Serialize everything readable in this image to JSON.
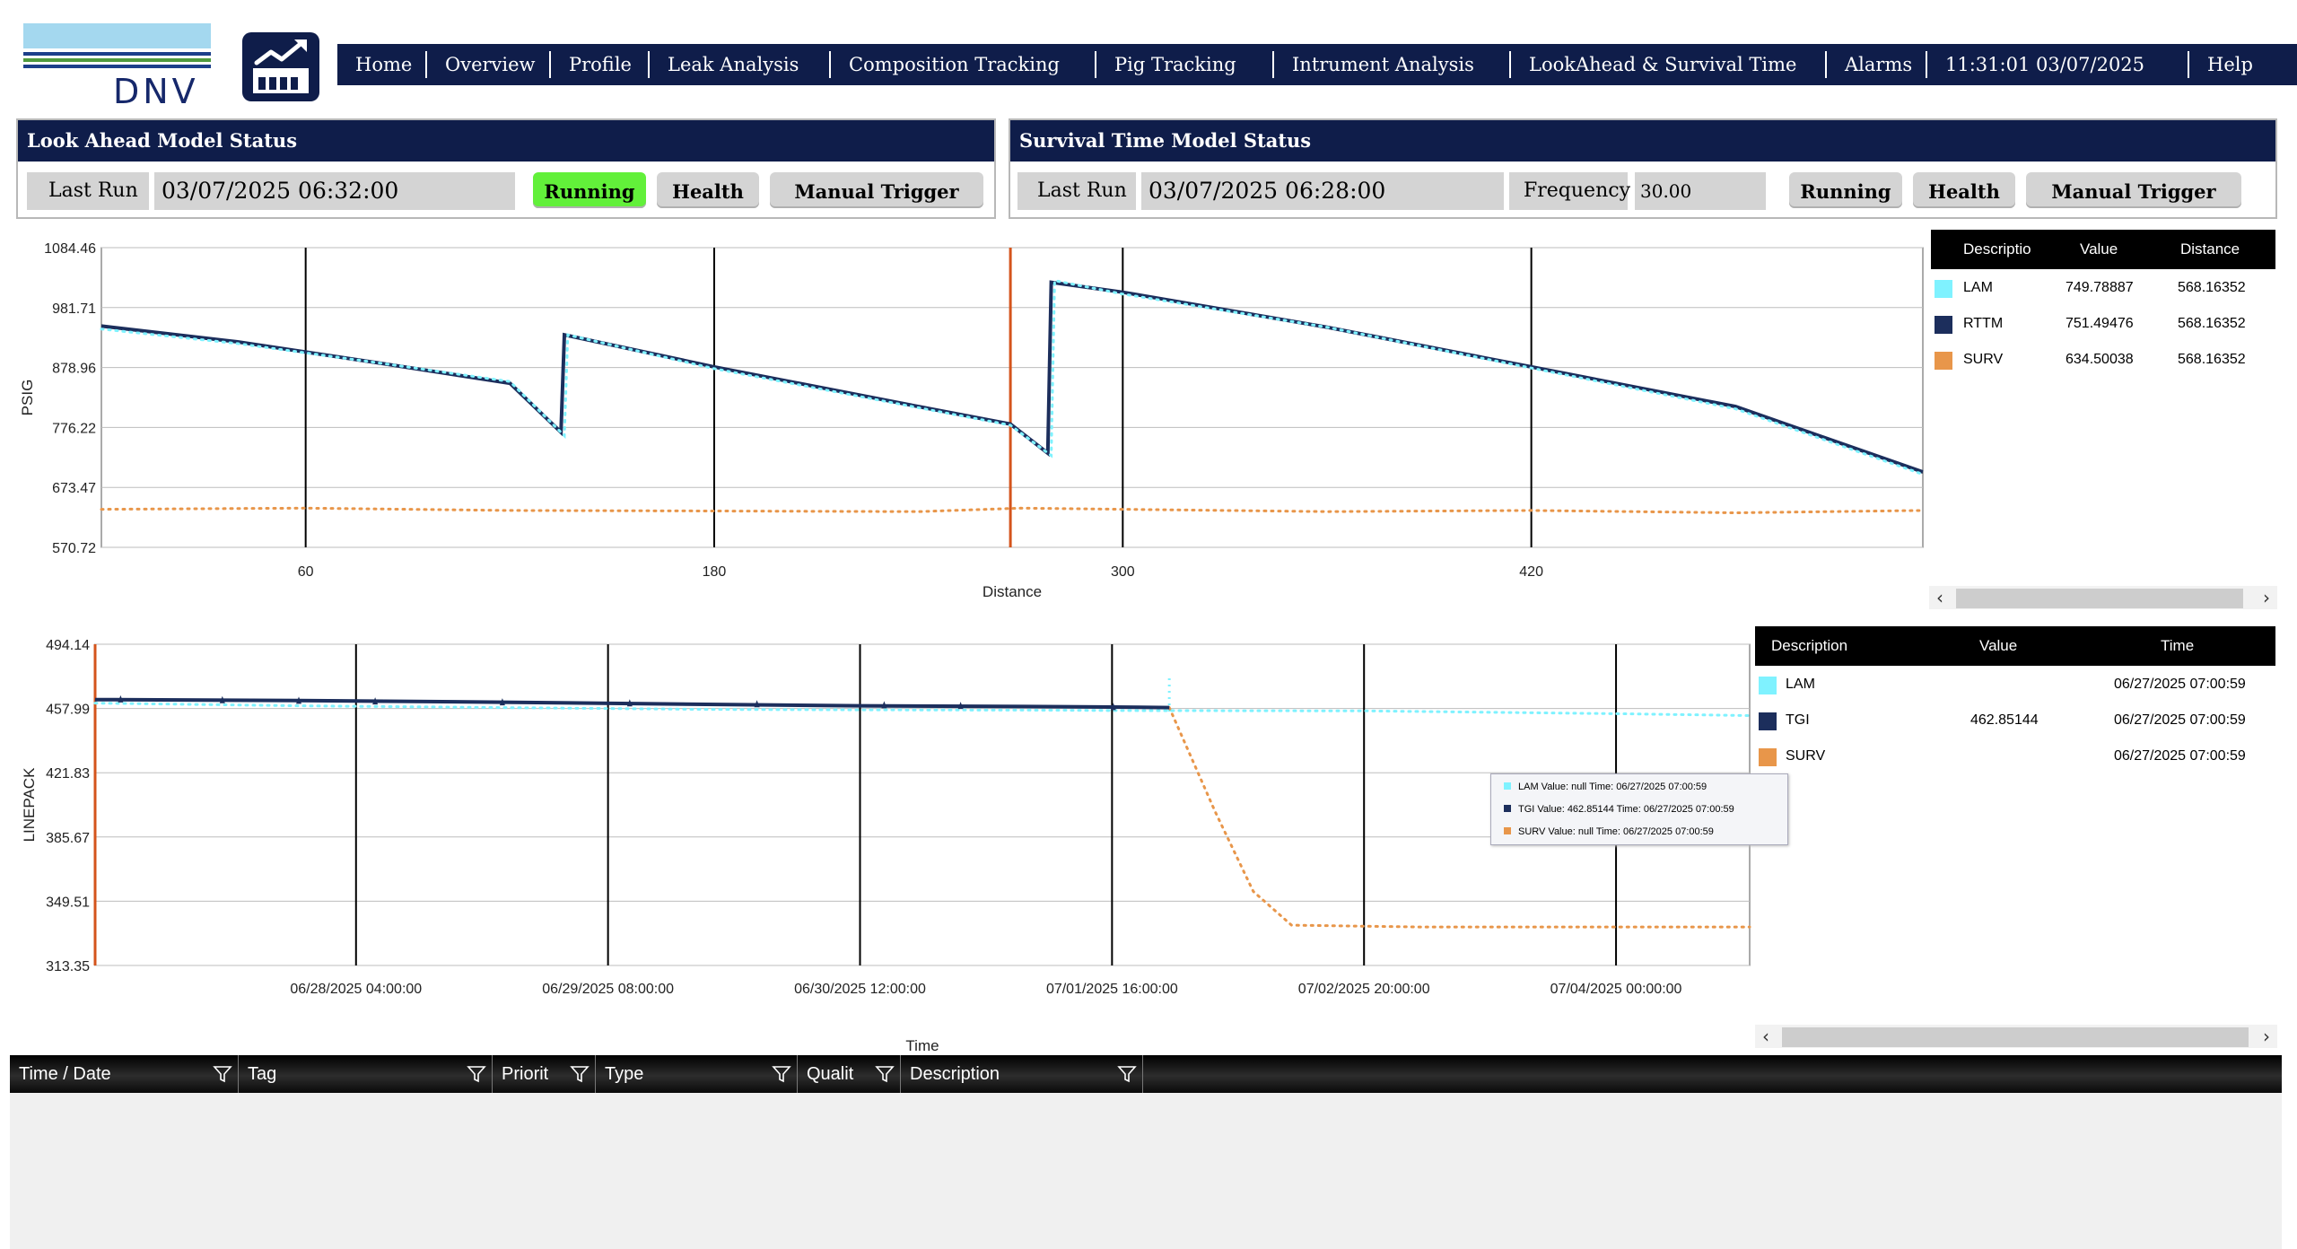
{
  "header": {
    "logo_text": "DNV",
    "nav": [
      "Home",
      "Overview",
      "Profile",
      "Leak Analysis",
      "Composition Tracking",
      "Pig Tracking",
      "Intrument Analysis",
      "LookAhead & Survival Time",
      "Alarms",
      "11:31:01 03/07/2025",
      "Help"
    ]
  },
  "look_ahead": {
    "title": "Look Ahead Model Status",
    "last_run_label": "Last Run",
    "last_run_value": "03/07/2025 06:32:00",
    "status_button": "Running",
    "health_button": "Health",
    "trigger_button": "Manual Trigger"
  },
  "survival": {
    "title": "Survival Time Model Status",
    "last_run_label": "Last Run",
    "last_run_value": "03/07/2025 06:28:00",
    "frequency_label": "Frequency",
    "frequency_value": "30.00",
    "status_button": "Running",
    "health_button": "Health",
    "trigger_button": "Manual Trigger"
  },
  "profile_legend": {
    "headers": [
      "Descriptio",
      "Value",
      "Distance"
    ],
    "rows": [
      {
        "name": "LAM",
        "value": "749.78887",
        "distance": "568.16352",
        "color": "#7ff2ff"
      },
      {
        "name": "RTTM",
        "value": "751.49476",
        "distance": "568.16352",
        "color": "#1c2e5c"
      },
      {
        "name": "SURV",
        "value": "634.50038",
        "distance": "568.16352",
        "color": "#e8964a"
      }
    ]
  },
  "linepack_legend": {
    "headers": [
      "Description",
      "Value",
      "Time"
    ],
    "rows": [
      {
        "name": "LAM",
        "value": "",
        "time": "06/27/2025 07:00:59",
        "color": "#7ff2ff"
      },
      {
        "name": "TGI",
        "value": "462.85144",
        "time": "06/27/2025 07:00:59",
        "color": "#1c2e5c"
      },
      {
        "name": "SURV",
        "value": "",
        "time": "06/27/2025 07:00:59",
        "color": "#e8964a"
      }
    ]
  },
  "tooltip": {
    "lines": [
      {
        "text": "LAM Value: null Time: 06/27/2025 07:00:59",
        "color": "#7ff2ff"
      },
      {
        "text": "TGI Value: 462.85144 Time: 06/27/2025 07:00:59",
        "color": "#1c2e5c"
      },
      {
        "text": "SURV Value: null Time: 06/27/2025 07:00:59",
        "color": "#e8964a"
      }
    ]
  },
  "alarm_grid": {
    "columns": [
      "Time / Date",
      "Tag",
      "Priorit",
      "Type",
      "Qualit",
      "Description"
    ]
  },
  "chart_data": [
    {
      "type": "line",
      "xlabel": "Distance",
      "ylabel": "PSIG",
      "xlim": [
        0,
        535
      ],
      "ylim": [
        570.72,
        1084.46
      ],
      "xticks": [
        60,
        180,
        300,
        420
      ],
      "yticks": [
        "570.72",
        "673.47",
        "776.22",
        "878.96",
        "981.71",
        "1084.46"
      ],
      "marker_x": 267,
      "series": [
        {
          "name": "LAM",
          "color": "#7ff2ff",
          "style": "dotted",
          "x": [
            0,
            40,
            80,
            120,
            136,
            137,
            180,
            240,
            267,
            279,
            280,
            300,
            360,
            420,
            480,
            535
          ],
          "y": [
            945,
            920,
            888,
            855,
            762,
            935,
            877,
            810,
            780,
            728,
            1028,
            1005,
            948,
            878,
            808,
            696
          ]
        },
        {
          "name": "RTTM",
          "color": "#1c2e5c",
          "style": "solid",
          "x": [
            0,
            40,
            80,
            120,
            135,
            136,
            180,
            240,
            267,
            278,
            279,
            300,
            360,
            420,
            480,
            535
          ],
          "y": [
            950,
            923,
            888,
            852,
            768,
            935,
            880,
            812,
            782,
            732,
            1025,
            1008,
            948,
            880,
            812,
            700
          ]
        },
        {
          "name": "SURV",
          "color": "#e8964a",
          "style": "dotted",
          "x": [
            0,
            60,
            120,
            180,
            240,
            270,
            300,
            360,
            420,
            480,
            535
          ],
          "y": [
            636,
            638,
            634,
            633,
            632,
            638,
            636,
            632,
            634,
            630,
            634
          ]
        }
      ]
    },
    {
      "type": "line",
      "xlabel": "Time",
      "ylabel": "LINEPACK",
      "ylim": [
        313.35,
        494.14
      ],
      "xticks": [
        "06/28/2025 04:00:00",
        "06/29/2025 08:00:00",
        "06/30/2025 12:00:00",
        "07/01/2025 16:00:00",
        "07/02/2025 20:00:00",
        "07/04/2025 00:00:00"
      ],
      "yticks": [
        "313.35",
        "349.51",
        "385.67",
        "421.83",
        "457.99",
        "494.14"
      ],
      "series": [
        {
          "name": "LAM",
          "color": "#7ff2ff",
          "style": "dotted",
          "x": [
            0,
            8,
            16,
            24,
            30,
            38,
            40,
            50,
            60,
            65
          ],
          "y": [
            461,
            459.5,
            458.5,
            457.5,
            457.2,
            457,
            456.8,
            456.6,
            455,
            454
          ]
        },
        {
          "name": "TGI",
          "color": "#1c2e5c",
          "style": "solid",
          "x": [
            0,
            8,
            16,
            24,
            30,
            38,
            40,
            42.2
          ],
          "y": [
            463,
            462.5,
            461.5,
            460.3,
            459.5,
            459,
            458.8,
            458.5
          ]
        },
        {
          "name": "SURV",
          "color": "#e8964a",
          "style": "dotted",
          "x": [
            42.2,
            44,
            45.5,
            47,
            52,
            65
          ],
          "y": [
            458.5,
            400,
            355,
            336,
            335,
            335
          ]
        }
      ]
    }
  ]
}
